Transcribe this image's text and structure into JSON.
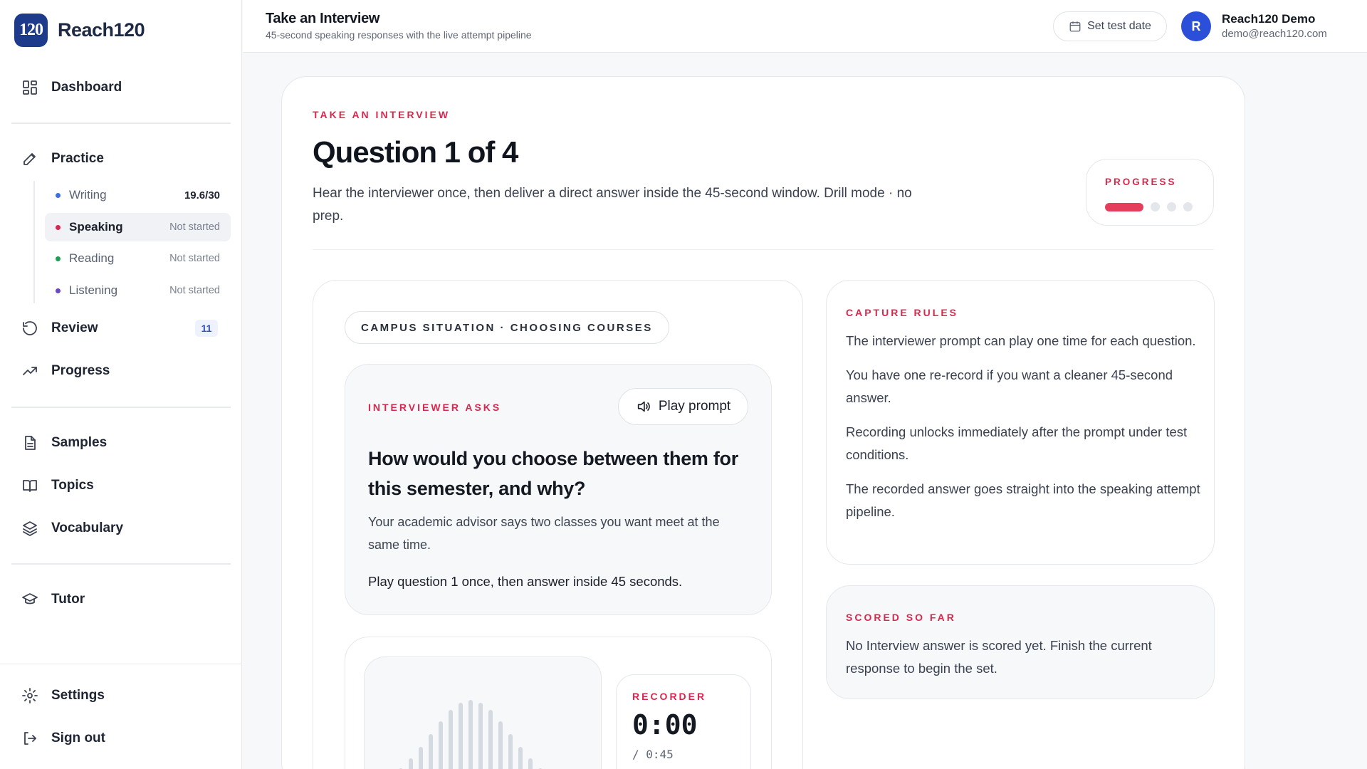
{
  "brand": {
    "logo_text": "120",
    "name": "Reach120"
  },
  "sidebar": {
    "dashboard": "Dashboard",
    "practice": "Practice",
    "sub_items": [
      {
        "label": "Writing",
        "status": "19.6/30",
        "dot_color": "#3b6fe0"
      },
      {
        "label": "Speaking",
        "status": "Not started",
        "dot_color": "#d7284d"
      },
      {
        "label": "Reading",
        "status": "Not started",
        "dot_color": "#1f9d55"
      },
      {
        "label": "Listening",
        "status": "Not started",
        "dot_color": "#6b46c1"
      }
    ],
    "review": "Review",
    "review_count": "11",
    "progress": "Progress",
    "samples": "Samples",
    "topics": "Topics",
    "vocabulary": "Vocabulary",
    "tutor": "Tutor",
    "settings": "Settings",
    "sign_out": "Sign out"
  },
  "header": {
    "title": "Take an Interview",
    "subtitle": "45-second speaking responses with the live attempt pipeline",
    "test_date_button": "Set test date",
    "user_initial": "R",
    "user_name": "Reach120 Demo",
    "user_email": "demo@reach120.com"
  },
  "main": {
    "eyebrow": "TAKE AN INTERVIEW",
    "title": "Question 1 of 4",
    "description": "Hear the interviewer once, then deliver a direct answer inside the 45-second window. Drill mode · no prep.",
    "progress_label": "PROGRESS",
    "progress_current": 1,
    "progress_total": 4
  },
  "scenario": {
    "topic": "CAMPUS SITUATION · CHOOSING COURSES",
    "asks_label": "INTERVIEWER ASKS",
    "play_button": "Play prompt",
    "question": "How would you choose between them for this semester, and why?",
    "context": "Your academic advisor says two classes you want meet at the same time.",
    "instruction": "Play question 1 once, then answer inside 45 seconds."
  },
  "recorder": {
    "label": "RECORDER",
    "time": "0:00",
    "limit": "/ 0:45"
  },
  "rules": {
    "label": "CAPTURE RULES",
    "items": [
      "The interviewer prompt can play one time for each question.",
      "You have one re-record if you want a cleaner 45-second answer.",
      "Recording unlocks immediately after the prompt under test conditions.",
      "The recorded answer goes straight into the speaking attempt pipeline."
    ]
  },
  "scored": {
    "label": "SCORED SO FAR",
    "text": "No Interview answer is scored yet. Finish the current response to begin the set."
  },
  "colors": {
    "accent": "#d7284d",
    "brand": "#1e3a8a",
    "avatar": "#2b4fd8"
  }
}
